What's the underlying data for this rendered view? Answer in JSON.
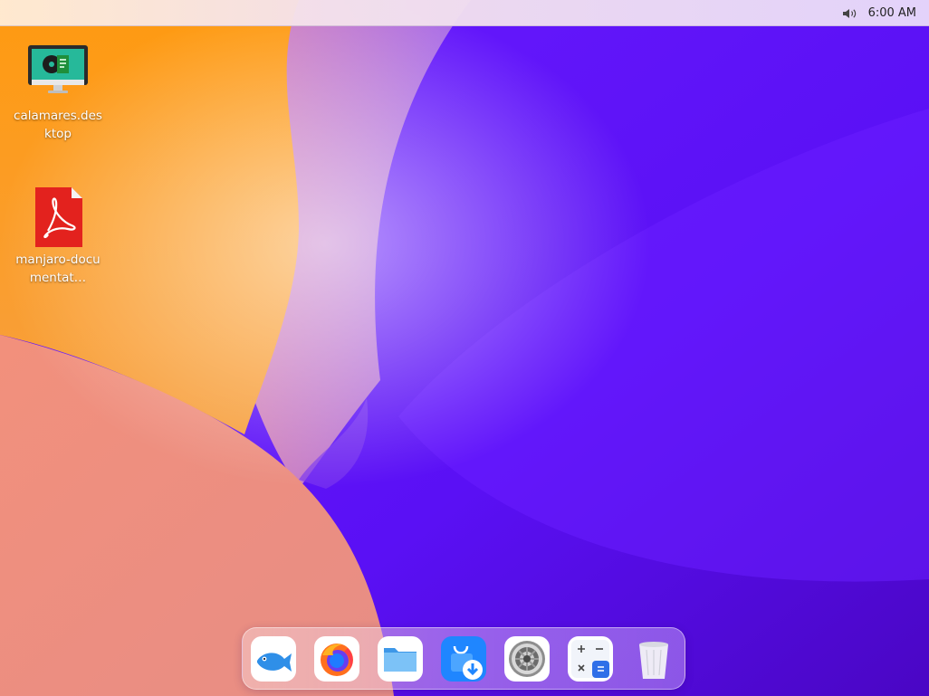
{
  "topbar": {
    "clock": "6:00 AM",
    "volume_icon": "volume-icon"
  },
  "desktop_icons": [
    {
      "label": "calamares.desktop",
      "icon": "installer-monitor-icon"
    },
    {
      "label": "manjaro-documentat…",
      "icon": "pdf-file-icon"
    }
  ],
  "dock": {
    "items": [
      {
        "name": "deepin-launcher",
        "icon": "fish-icon"
      },
      {
        "name": "firefox",
        "icon": "firefox-icon"
      },
      {
        "name": "file-manager",
        "icon": "folder-icon"
      },
      {
        "name": "app-store",
        "icon": "app-store-icon"
      },
      {
        "name": "system-settings",
        "icon": "gear-icon"
      },
      {
        "name": "calculator",
        "icon": "calculator-icon"
      },
      {
        "name": "trash",
        "icon": "trash-icon"
      }
    ]
  },
  "colors": {
    "wallpaper_orange": "#ff9a1f",
    "wallpaper_peach": "#ee8e7e",
    "wallpaper_violet": "#5f14ff",
    "clock_text": "#222222"
  }
}
